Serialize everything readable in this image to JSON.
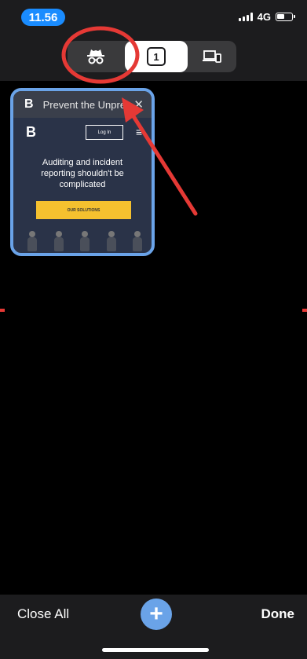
{
  "status": {
    "time": "11.56",
    "network": "4G",
    "battery_level": 0.55
  },
  "switcher": {
    "incognito_icon": "incognito-icon",
    "tab_count": "1",
    "devices_icon": "devices-icon"
  },
  "tab": {
    "title": "Prevent the Unpredictable",
    "favicon": "B",
    "close_glyph": "✕",
    "page": {
      "logo": "B",
      "login_label": "Log In",
      "menu_glyph": "≡",
      "headline_1": "Auditing and incident",
      "headline_2": "reporting shouldn't be",
      "headline_3": "complicated",
      "cta_label": "OUR SOLUTIONS"
    }
  },
  "toolbar": {
    "close_all_label": "Close All",
    "new_tab_glyph": "+",
    "done_label": "Done"
  },
  "colors": {
    "accent": "#6aa3e8",
    "annotation": "#e53935",
    "time_pill": "#1a8cff",
    "cta": "#f5c12f"
  }
}
